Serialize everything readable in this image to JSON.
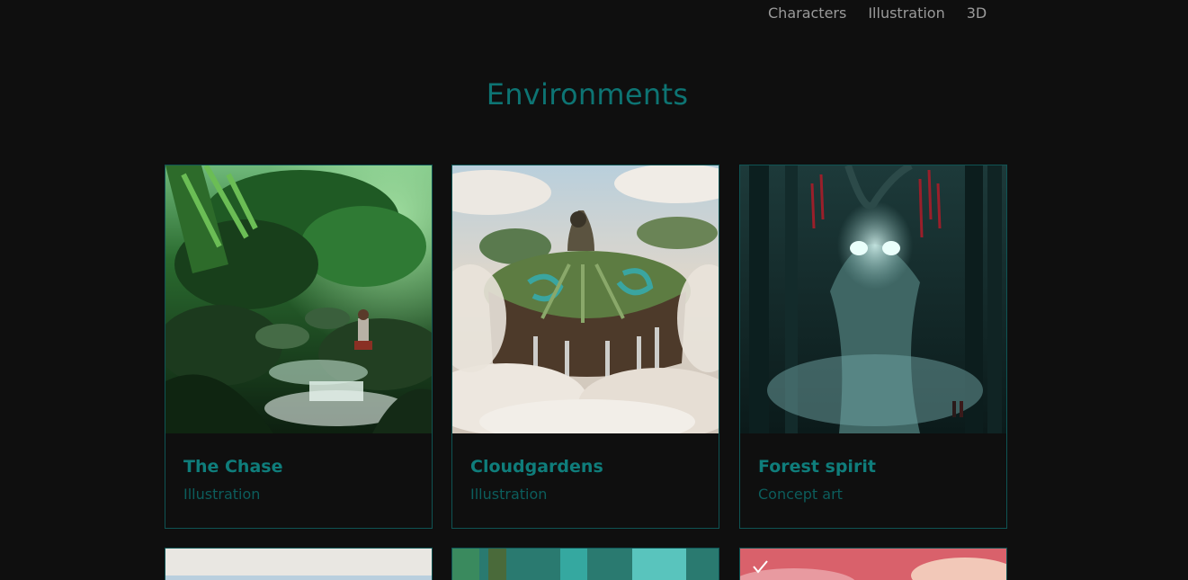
{
  "nav": {
    "items": [
      {
        "label": "Characters"
      },
      {
        "label": "Illustration"
      },
      {
        "label": "3D"
      }
    ]
  },
  "section": {
    "title": "Environments"
  },
  "cards": [
    {
      "title": "The Chase",
      "category": "Illustration"
    },
    {
      "title": "Cloudgardens",
      "category": "Illustration"
    },
    {
      "title": "Forest spirit",
      "category": "Concept art"
    }
  ],
  "colors": {
    "background": "#0f0f0f",
    "accent": "#0d7473",
    "card_border": "#0f5454",
    "nav_text": "#9a9a9a"
  }
}
